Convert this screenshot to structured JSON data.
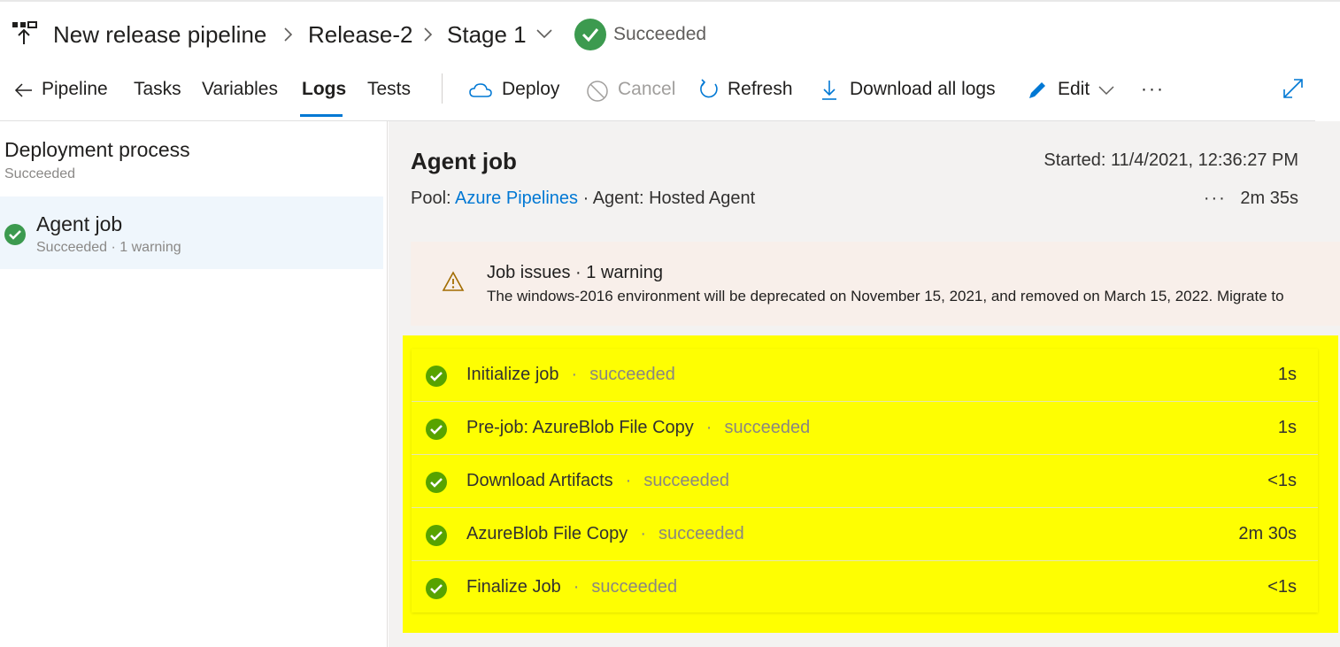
{
  "header": {
    "pipeline_name": "New release pipeline",
    "release": "Release-2",
    "stage": "Stage 1",
    "status": "Succeeded"
  },
  "toolbar": {
    "back_label": "Pipeline",
    "tabs": [
      {
        "label": "Tasks"
      },
      {
        "label": "Variables"
      },
      {
        "label": "Logs",
        "active": true
      },
      {
        "label": "Tests"
      }
    ],
    "deploy_label": "Deploy",
    "cancel_label": "Cancel",
    "refresh_label": "Refresh",
    "download_label": "Download all logs",
    "edit_label": "Edit",
    "more_label": "···"
  },
  "sidebar": {
    "title": "Deployment process",
    "status": "Succeeded",
    "job": {
      "name": "Agent job",
      "status": "Succeeded · 1 warning"
    }
  },
  "job": {
    "title": "Agent job",
    "started": "Started: 11/4/2021, 12:36:27 PM",
    "pool_label": "Pool:",
    "pool_value": "Azure Pipelines",
    "agent": "· Agent: Hosted Agent",
    "more": "···",
    "duration": "2m 35s",
    "issues_title": "Job issues · 1 warning",
    "issues_message": "The windows-2016 environment will be deprecated on November 15, 2021, and removed on March 15, 2022. Migrate to",
    "steps": [
      {
        "name": "Initialize job",
        "status": "succeeded",
        "time": "1s"
      },
      {
        "name": "Pre-job: AzureBlob File Copy",
        "status": "succeeded",
        "time": "1s"
      },
      {
        "name": "Download Artifacts",
        "status": "succeeded",
        "time": "<1s"
      },
      {
        "name": "AzureBlob File Copy",
        "status": "succeeded",
        "time": "2m 30s"
      },
      {
        "name": "Finalize Job",
        "status": "succeeded",
        "time": "<1s"
      }
    ]
  },
  "colors": {
    "accent": "#0078d4",
    "success": "#3c9a4f",
    "step_success": "#57a300",
    "highlight": "#ffff00",
    "warning_bg": "#f8efea"
  }
}
